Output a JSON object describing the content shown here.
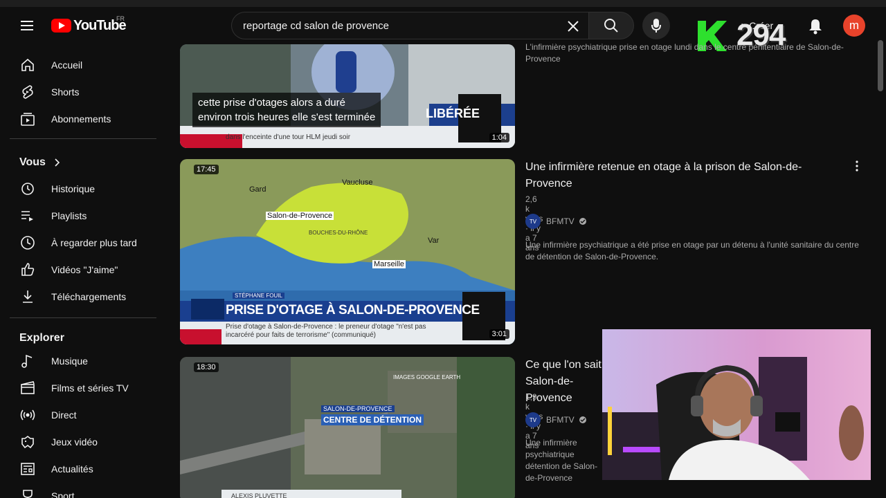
{
  "header": {
    "logo_text": "YouTube",
    "region": "FR",
    "search_value": "reportage cd salon de provence",
    "create_label": "Créer",
    "avatar_letter": "m"
  },
  "overlay": {
    "badge_letter": "K",
    "count": "294"
  },
  "sidebar": {
    "main": [
      {
        "label": "Accueil",
        "icon": "home-icon"
      },
      {
        "label": "Shorts",
        "icon": "shorts-icon"
      },
      {
        "label": "Abonnements",
        "icon": "subscriptions-icon"
      }
    ],
    "you_title": "Vous",
    "you": [
      {
        "label": "Historique",
        "icon": "history-icon"
      },
      {
        "label": "Playlists",
        "icon": "playlists-icon"
      },
      {
        "label": "À regarder plus tard",
        "icon": "clock-icon"
      },
      {
        "label": "Vidéos \"J'aime\"",
        "icon": "thumbs-up-icon"
      },
      {
        "label": "Téléchargements",
        "icon": "download-icon"
      }
    ],
    "explore_title": "Explorer",
    "explore": [
      {
        "label": "Musique",
        "icon": "music-icon"
      },
      {
        "label": "Films et séries TV",
        "icon": "film-icon"
      },
      {
        "label": "Direct",
        "icon": "live-icon"
      },
      {
        "label": "Jeux vidéo",
        "icon": "gaming-icon"
      },
      {
        "label": "Actualités",
        "icon": "news-icon"
      },
      {
        "label": "Sport",
        "icon": "sport-icon"
      }
    ]
  },
  "results": [
    {
      "description": "L'infirmière psychiatrique prise en otage lundi dans le centre pénitentiaire de Salon-de-Provence",
      "subtitle_line1": "cette prise d'otages alors a duré",
      "subtitle_line2": "environ trois heures elle s'est terminée",
      "banner": "LIBÉRÉE",
      "ticker": "dans l'enceinte d'une tour HLM jeudi soir",
      "duration": "1:04"
    },
    {
      "timestamp": "17:45",
      "title": "Une infirmière retenue en otage à la prison de Salon-de-Provence",
      "meta": "2,6 k vues · il y a 7 ans",
      "channel": "BFMTV",
      "description": "Une infirmière psychiatrique a été prise en otage par un détenu à l'unité sanitaire du centre de détention de Salon-de-Provence.",
      "map_labels": [
        "Gard",
        "Vaucluse",
        "Salon-de-Provence",
        "BOUCHES-DU-RHÔNE",
        "Var",
        "Marseille"
      ],
      "reporter": "STÉPHANE FOUIL",
      "banner": "PRISE D'OTAGE À SALON-DE-PROVENCE",
      "ticker": "Prise d'otage à Salon-de-Provence : le preneur d'otage \"n'est pas incarcéré pour faits de terrorisme\" (communiqué)",
      "duration": "3:01"
    },
    {
      "timestamp": "18:30",
      "title": "Ce que l'on sait Salon-de-Provence",
      "meta": "1,9 k vues · il y a 7 ans",
      "channel": "BFMTV",
      "description": "Une infirmière psychiatrique détention de Salon-de-Provence",
      "map_label1": "SALON-DE-PROVENCE",
      "map_label2": "CENTRE DE DÉTENTION",
      "source": "IMAGES GOOGLE EARTH",
      "reporter": "ALEXIS PLUVETTE"
    }
  ]
}
